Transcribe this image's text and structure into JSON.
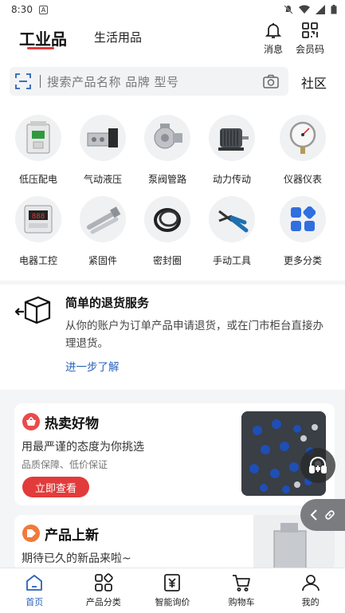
{
  "status_bar": {
    "time": "8:30",
    "badge": "A"
  },
  "header": {
    "active_tab": "工业品",
    "inactive_tab": "生活用品",
    "messages_label": "消息",
    "member_label": "会员码",
    "accent_color": "#e23b3b"
  },
  "search": {
    "placeholder": "搜索产品名称 品牌 型号",
    "community_label": "社区"
  },
  "categories": [
    {
      "label": "低压配电",
      "icon": "breaker-icon"
    },
    {
      "label": "气动液压",
      "icon": "valve-icon"
    },
    {
      "label": "泵阀管路",
      "icon": "pump-icon"
    },
    {
      "label": "动力传动",
      "icon": "motor-icon"
    },
    {
      "label": "仪器仪表",
      "icon": "gauge-icon"
    },
    {
      "label": "电器工控",
      "icon": "meter-icon"
    },
    {
      "label": "紧固件",
      "icon": "bolt-icon"
    },
    {
      "label": "密封圈",
      "icon": "oring-icon"
    },
    {
      "label": "手动工具",
      "icon": "pliers-icon"
    },
    {
      "label": "更多分类",
      "icon": "grid-icon"
    }
  ],
  "return_service": {
    "title": "简单的退货服务",
    "description": "从你的账户为订单产品申请退货，或在门市柜台直接办理退货。",
    "link": "进一步了解"
  },
  "hot_card": {
    "title": "热卖好物",
    "subtitle": "用最严谨的态度为你挑选",
    "tagline": "品质保障、低价保证",
    "button": "立即查看"
  },
  "new_card": {
    "title": "产品上新",
    "subtitle": "期待已久的新品来啦~"
  },
  "bottom_nav": [
    {
      "label": "首页",
      "icon": "home-icon",
      "active": true
    },
    {
      "label": "产品分类",
      "icon": "category-icon",
      "active": false
    },
    {
      "label": "智能询价",
      "icon": "quote-icon",
      "active": false
    },
    {
      "label": "购物车",
      "icon": "cart-icon",
      "active": false
    },
    {
      "label": "我的",
      "icon": "profile-icon",
      "active": false
    }
  ],
  "colors": {
    "primary_blue": "#2a62b8",
    "brand_red": "#e23b3b"
  }
}
